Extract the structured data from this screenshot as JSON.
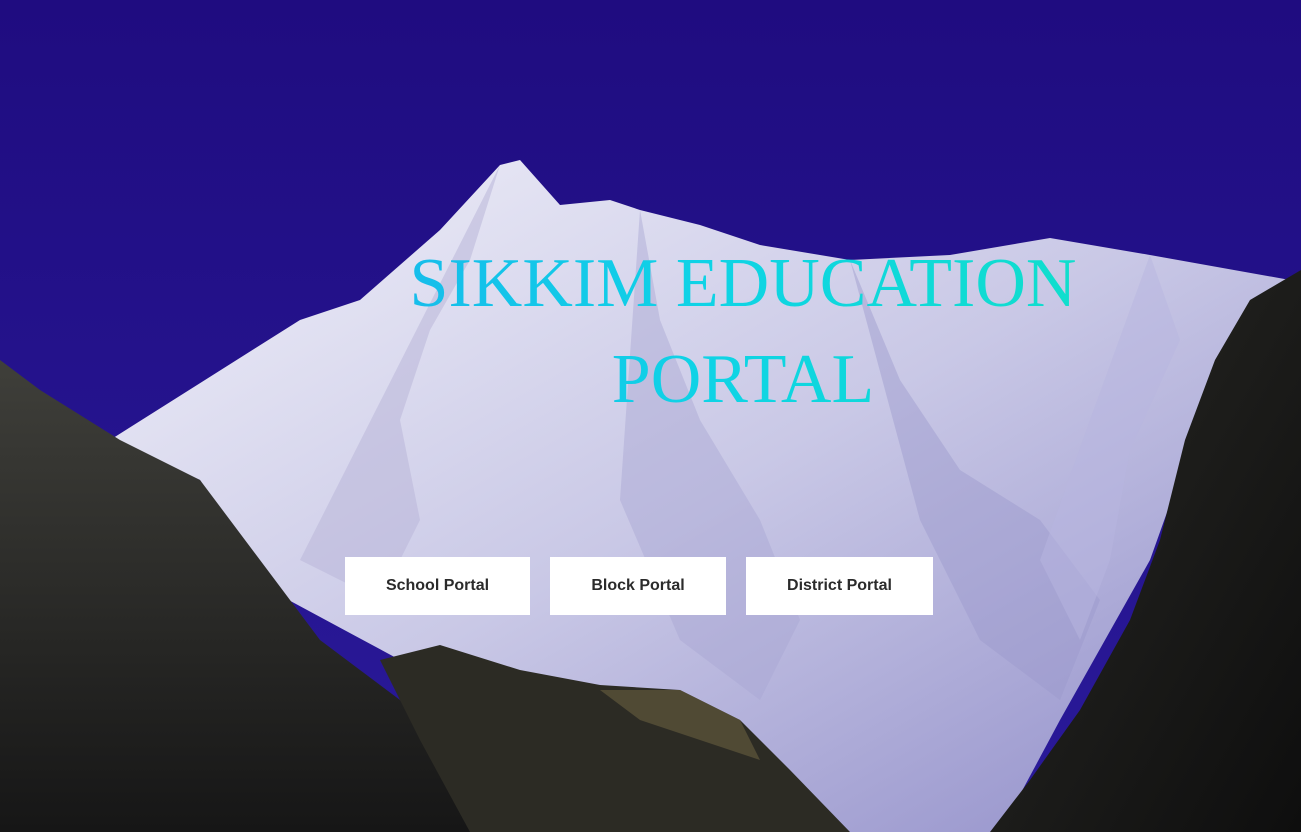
{
  "hero": {
    "title_line1": "SIKKIM EDUCATION",
    "title_line2": "PORTAL",
    "background_description": "snow-capped-mountain-photo"
  },
  "portals": {
    "school_label": "School Portal",
    "block_label": "Block Portal",
    "district_label": "District Portal"
  },
  "colors": {
    "sky": "#22108a",
    "title_cyan": "#10d8e0",
    "button_bg": "#ffffff",
    "button_text": "#2b2b2b"
  }
}
